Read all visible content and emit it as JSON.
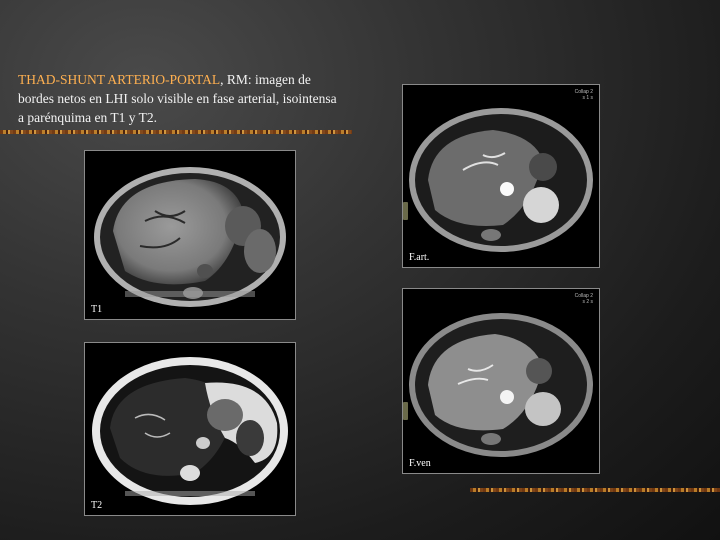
{
  "caption": {
    "accent": "THAD-SHUNT ARTERIO-PORTAL",
    "rest": ", RM: imagen de bordes netos en LHI solo visible en fase arterial, isointensa a parénquima en T1 y T2."
  },
  "panels": {
    "t1": {
      "label": "T1"
    },
    "t2": {
      "label": "T2"
    },
    "art": {
      "label": "F.art.",
      "corner1": "Collap 2",
      "corner2": "s 1 s"
    },
    "ven": {
      "label": "F.ven",
      "corner1": "Collap 2",
      "corner2": "s 2 s"
    }
  },
  "colors": {
    "accent": "#ffb050",
    "text": "#f2f2f2"
  }
}
